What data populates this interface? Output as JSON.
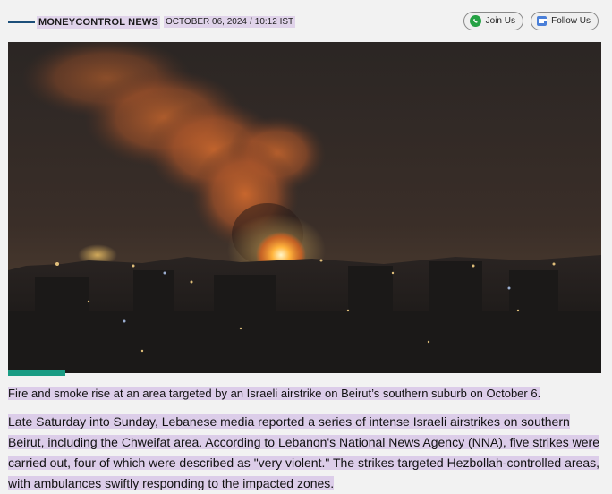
{
  "header": {
    "source": "MONEYCONTROL NEWS",
    "date": "OCTOBER 06, 2024",
    "time": "10:12 IST",
    "join_label": "Join Us",
    "follow_label": "Follow Us"
  },
  "photo": {
    "subject": "Fire and smoke over city at night"
  },
  "article": {
    "caption": "Fire and smoke rise at an area targeted by an Israeli airstrike on Beirut’s southern suburb on October 6.",
    "body": "Late Saturday into Sunday, Lebanese media reported a series of intense Israeli airstrikes on southern Beirut, including the Chweifat area. According to Lebanon's National News Agency (NNA), five strikes were carried out, four of which were described as \"very violent.\" The strikes targeted Hezbollah-controlled areas, with ambulances swiftly responding to the impacted zones."
  },
  "colors": {
    "accent": "#1a9c84",
    "highlight": "#dccde9",
    "whatsapp": "#25a244"
  }
}
